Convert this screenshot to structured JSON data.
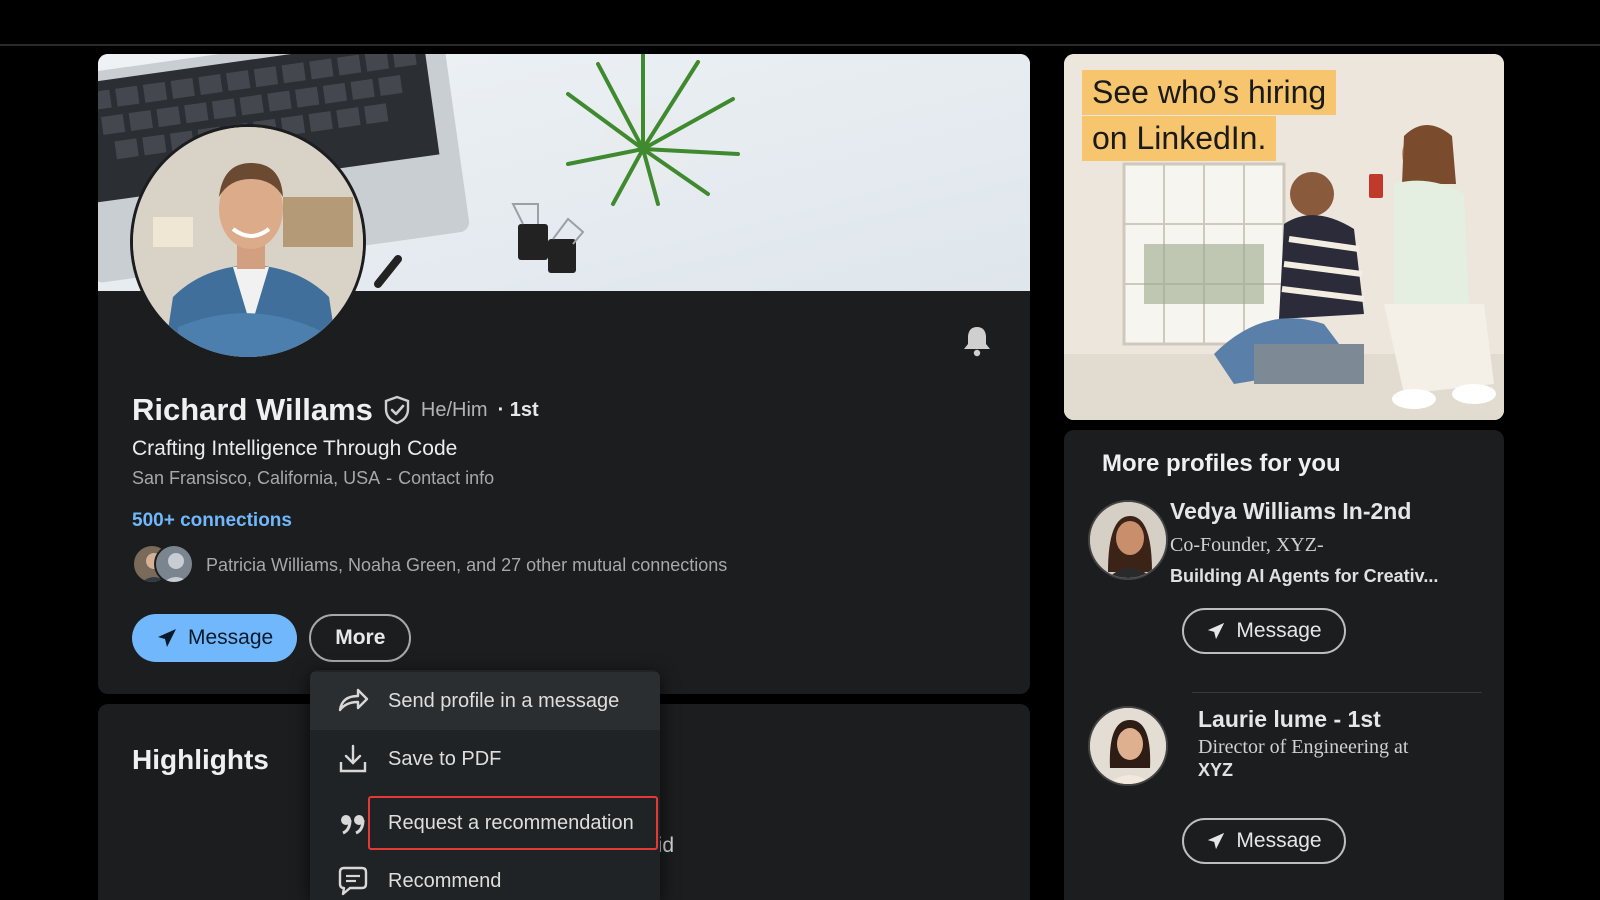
{
  "profile": {
    "name": "Richard Willams",
    "pronouns": "He/Him",
    "degree": "· 1st",
    "headline": "Crafting Intelligence Through Code",
    "location": "San Fransisco, California, USA",
    "location_sep": "-",
    "contact_info": "Contact info",
    "connections": "500+ connections",
    "mutual": "Patricia Williams, Noaha Green, and 27 other mutual connections",
    "message_label": "Message",
    "more_label": "More"
  },
  "highlights": {
    "title": "Highlights",
    "partial_text": "did"
  },
  "dropdown": {
    "items": [
      {
        "label": "Send profile in a message",
        "icon": "share-arrow-icon"
      },
      {
        "label": "Save to PDF",
        "icon": "download-icon"
      },
      {
        "label": "Request a recommendation",
        "icon": "quote-icon"
      },
      {
        "label": "Recommend",
        "icon": "chat-bubble-icon"
      }
    ]
  },
  "ad": {
    "line1": "See who’s hiring",
    "line2": "on LinkedIn."
  },
  "side": {
    "title": "More profiles for you",
    "people": [
      {
        "name": "Vedya Williams In-2nd",
        "role": "Co-Founder, XYZ-",
        "extra": "Building AI Agents for Creativ...",
        "button": "Message"
      },
      {
        "name": "Laurie lume - 1st",
        "role": "Director of Engineering at",
        "extra": "XYZ",
        "button": "Message"
      }
    ]
  },
  "colors": {
    "accent": "#71b7fb",
    "card": "#1b1d1f",
    "highlight_border": "#e53935",
    "ad_label": "#f6c56e"
  }
}
